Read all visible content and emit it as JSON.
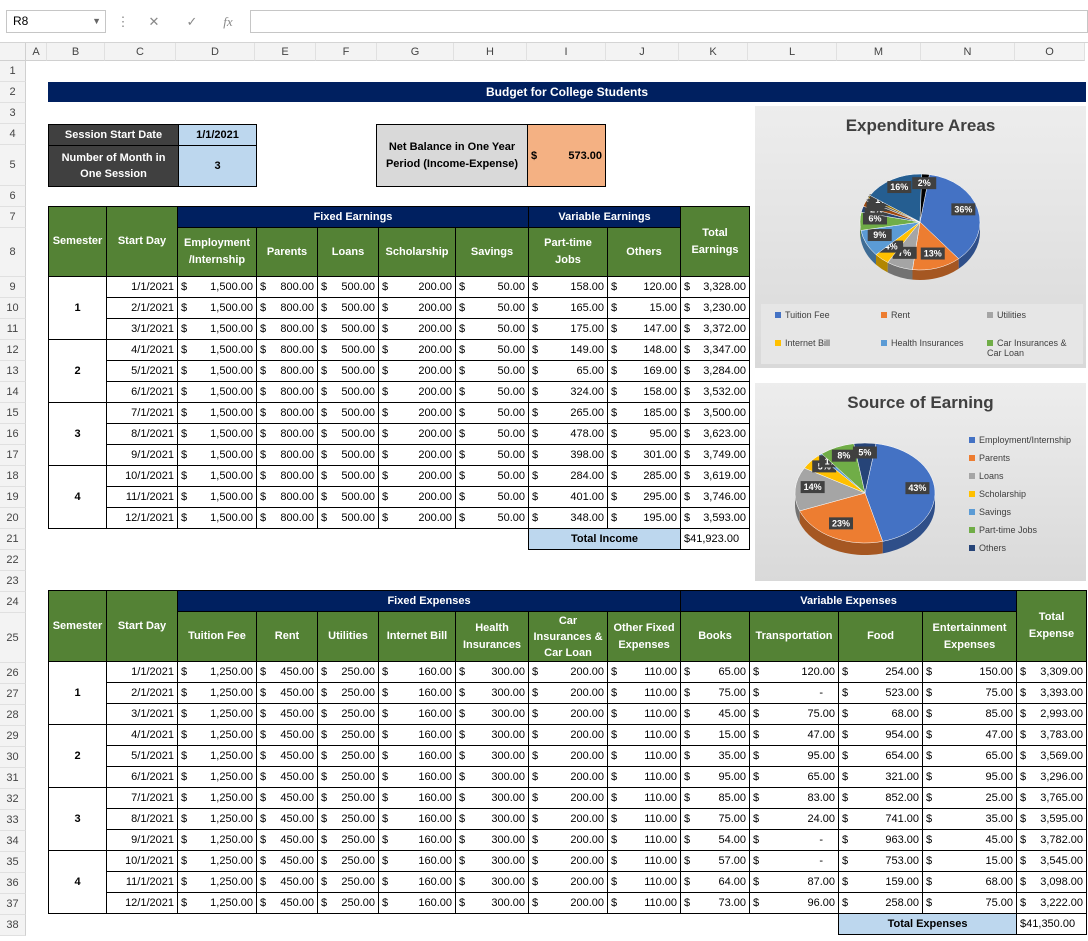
{
  "namebox": "R8",
  "fx": "fx",
  "columns": [
    "A",
    "B",
    "C",
    "D",
    "E",
    "F",
    "G",
    "H",
    "I",
    "J",
    "K",
    "L",
    "M",
    "N",
    "O"
  ],
  "title": "Budget for College Students",
  "session": {
    "start_label": "Session Start Date",
    "start_value": "1/1/2021",
    "months_label": "Number of Month in One Session",
    "months_value": "3"
  },
  "net": {
    "label": "Net Balance in One Year Period (Income-Expense)",
    "cur": "$",
    "value": "573.00"
  },
  "earn": {
    "h_sem": "Semester",
    "h_start": "Start Day",
    "h_fixed": "Fixed Earnings",
    "h_var": "Variable Earnings",
    "h_total": "Total Earnings",
    "cols": [
      "Employment /Internship",
      "Parents",
      "Loans",
      "Scholarship",
      "Savings",
      "Part-time Jobs",
      "Others"
    ],
    "rows": [
      [
        "1/1/2021",
        "1,500.00",
        "800.00",
        "500.00",
        "200.00",
        "50.00",
        "158.00",
        "120.00",
        "3,328.00"
      ],
      [
        "2/1/2021",
        "1,500.00",
        "800.00",
        "500.00",
        "200.00",
        "50.00",
        "165.00",
        "15.00",
        "3,230.00"
      ],
      [
        "3/1/2021",
        "1,500.00",
        "800.00",
        "500.00",
        "200.00",
        "50.00",
        "175.00",
        "147.00",
        "3,372.00"
      ],
      [
        "4/1/2021",
        "1,500.00",
        "800.00",
        "500.00",
        "200.00",
        "50.00",
        "149.00",
        "148.00",
        "3,347.00"
      ],
      [
        "5/1/2021",
        "1,500.00",
        "800.00",
        "500.00",
        "200.00",
        "50.00",
        "65.00",
        "169.00",
        "3,284.00"
      ],
      [
        "6/1/2021",
        "1,500.00",
        "800.00",
        "500.00",
        "200.00",
        "50.00",
        "324.00",
        "158.00",
        "3,532.00"
      ],
      [
        "7/1/2021",
        "1,500.00",
        "800.00",
        "500.00",
        "200.00",
        "50.00",
        "265.00",
        "185.00",
        "3,500.00"
      ],
      [
        "8/1/2021",
        "1,500.00",
        "800.00",
        "500.00",
        "200.00",
        "50.00",
        "478.00",
        "95.00",
        "3,623.00"
      ],
      [
        "9/1/2021",
        "1,500.00",
        "800.00",
        "500.00",
        "200.00",
        "50.00",
        "398.00",
        "301.00",
        "3,749.00"
      ],
      [
        "10/1/2021",
        "1,500.00",
        "800.00",
        "500.00",
        "200.00",
        "50.00",
        "284.00",
        "285.00",
        "3,619.00"
      ],
      [
        "11/1/2021",
        "1,500.00",
        "800.00",
        "500.00",
        "200.00",
        "50.00",
        "401.00",
        "295.00",
        "3,746.00"
      ],
      [
        "12/1/2021",
        "1,500.00",
        "800.00",
        "500.00",
        "200.00",
        "50.00",
        "348.00",
        "195.00",
        "3,593.00"
      ]
    ],
    "total_label": "Total Income",
    "total_value": "$41,923.00"
  },
  "exp": {
    "h_fixed": "Fixed Expenses",
    "h_var": "Variable Expenses",
    "h_total": "Total Expense",
    "cols": [
      "Tuition Fee",
      "Rent",
      "Utilities",
      "Internet Bill",
      "Health Insurances",
      "Car Insurances & Car Loan",
      "Other Fixed Expenses",
      "Books",
      "Transportation",
      "Food",
      "Entertainment Expenses"
    ],
    "rows": [
      [
        "1/1/2021",
        "1,250.00",
        "450.00",
        "250.00",
        "160.00",
        "300.00",
        "200.00",
        "110.00",
        "65.00",
        "120.00",
        "254.00",
        "150.00",
        "3,309.00"
      ],
      [
        "2/1/2021",
        "1,250.00",
        "450.00",
        "250.00",
        "160.00",
        "300.00",
        "200.00",
        "110.00",
        "75.00",
        "-",
        "523.00",
        "75.00",
        "3,393.00"
      ],
      [
        "3/1/2021",
        "1,250.00",
        "450.00",
        "250.00",
        "160.00",
        "300.00",
        "200.00",
        "110.00",
        "45.00",
        "75.00",
        "68.00",
        "85.00",
        "2,993.00"
      ],
      [
        "4/1/2021",
        "1,250.00",
        "450.00",
        "250.00",
        "160.00",
        "300.00",
        "200.00",
        "110.00",
        "15.00",
        "47.00",
        "954.00",
        "47.00",
        "3,783.00"
      ],
      [
        "5/1/2021",
        "1,250.00",
        "450.00",
        "250.00",
        "160.00",
        "300.00",
        "200.00",
        "110.00",
        "35.00",
        "95.00",
        "654.00",
        "65.00",
        "3,569.00"
      ],
      [
        "6/1/2021",
        "1,250.00",
        "450.00",
        "250.00",
        "160.00",
        "300.00",
        "200.00",
        "110.00",
        "95.00",
        "65.00",
        "321.00",
        "95.00",
        "3,296.00"
      ],
      [
        "7/1/2021",
        "1,250.00",
        "450.00",
        "250.00",
        "160.00",
        "300.00",
        "200.00",
        "110.00",
        "85.00",
        "83.00",
        "852.00",
        "25.00",
        "3,765.00"
      ],
      [
        "8/1/2021",
        "1,250.00",
        "450.00",
        "250.00",
        "160.00",
        "300.00",
        "200.00",
        "110.00",
        "75.00",
        "24.00",
        "741.00",
        "35.00",
        "3,595.00"
      ],
      [
        "9/1/2021",
        "1,250.00",
        "450.00",
        "250.00",
        "160.00",
        "300.00",
        "200.00",
        "110.00",
        "54.00",
        "-",
        "963.00",
        "45.00",
        "3,782.00"
      ],
      [
        "10/1/2021",
        "1,250.00",
        "450.00",
        "250.00",
        "160.00",
        "300.00",
        "200.00",
        "110.00",
        "57.00",
        "-",
        "753.00",
        "15.00",
        "3,545.00"
      ],
      [
        "11/1/2021",
        "1,250.00",
        "450.00",
        "250.00",
        "160.00",
        "300.00",
        "200.00",
        "110.00",
        "64.00",
        "87.00",
        "159.00",
        "68.00",
        "3,098.00"
      ],
      [
        "12/1/2021",
        "1,250.00",
        "450.00",
        "250.00",
        "160.00",
        "300.00",
        "200.00",
        "110.00",
        "73.00",
        "96.00",
        "258.00",
        "75.00",
        "3,222.00"
      ]
    ],
    "total_label": "Total Expenses",
    "total_value": "$41,350.00"
  },
  "chart_data": [
    {
      "type": "pie",
      "title": "Expenditure Areas",
      "categories": [
        "Tuition Fee",
        "Rent",
        "Utilities",
        "Internet Bill",
        "Health Insurances",
        "Car Insurances & Car Loan"
      ],
      "values": [
        36,
        13,
        7,
        4,
        9,
        6
      ],
      "extra_labels": [
        "2%",
        "2%",
        "1%",
        "1%",
        "16%",
        "2%"
      ],
      "colors": [
        "#4472c4",
        "#ed7d31",
        "#a5a5a5",
        "#ffc000",
        "#5b9bd5",
        "#70ad47",
        "#264478",
        "#9e480e",
        "#636363",
        "#997300",
        "#255e91"
      ]
    },
    {
      "type": "pie",
      "title": "Source of Earning",
      "categories": [
        "Employment/Internship",
        "Parents",
        "Loans",
        "Scholarship",
        "Savings",
        "Part-time Jobs",
        "Others"
      ],
      "values": [
        43,
        23,
        14,
        5,
        1,
        8,
        5
      ],
      "colors": [
        "#4472c4",
        "#ed7d31",
        "#a5a5a5",
        "#ffc000",
        "#5b9bd5",
        "#70ad47",
        "#264478"
      ]
    }
  ]
}
